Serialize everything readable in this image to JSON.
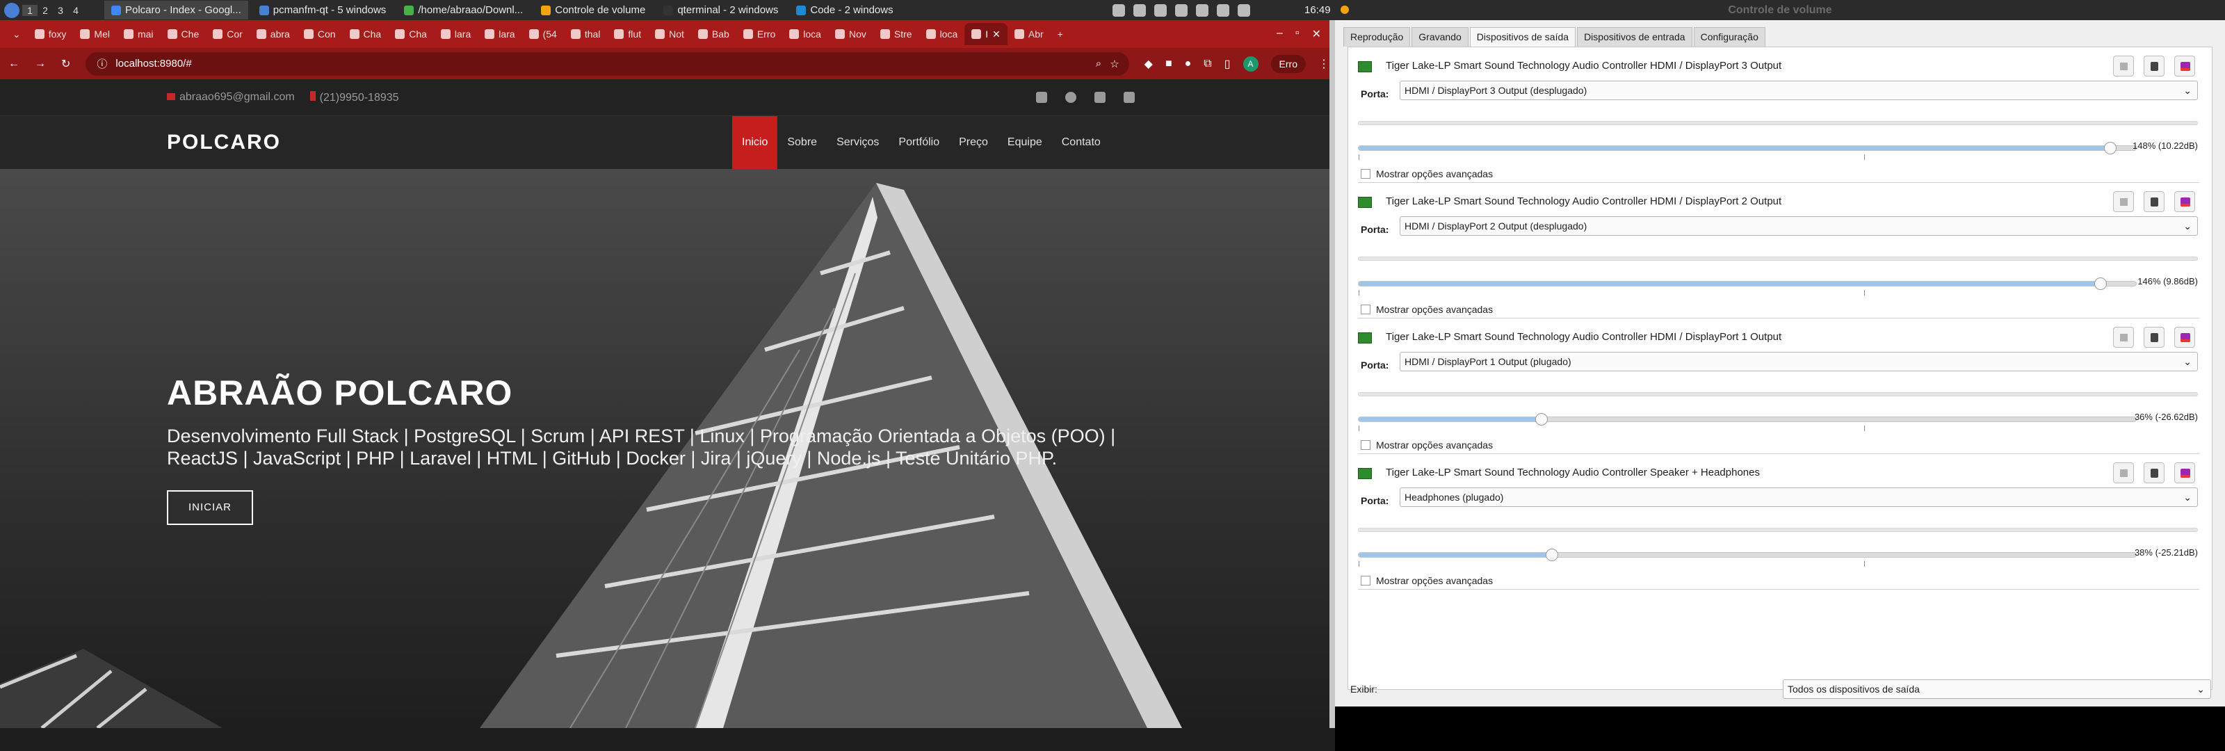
{
  "taskbar": {
    "workspaces": [
      "1",
      "2",
      "3",
      "4"
    ],
    "tasks": [
      {
        "label": "Polcaro - Index - Googl...",
        "color": "#4285f4",
        "active": true
      },
      {
        "label": "pcmanfm-qt - 5 windows",
        "color": "#4a7fd6",
        "active": false
      },
      {
        "label": "/home/abraao/Downl...",
        "color": "#48b04a",
        "active": false
      },
      {
        "label": "Controle de volume",
        "color": "#f5a30f",
        "active": false
      },
      {
        "label": "qterminal - 2 windows",
        "color": "#333333",
        "active": false
      },
      {
        "label": "Code - 2 windows",
        "color": "#1f8ad2",
        "active": false
      }
    ],
    "clock": "16:49",
    "window_title": "Controle de volume"
  },
  "browser": {
    "tabs": [
      "foxy",
      "Mel",
      "mai",
      "Che",
      "Cor",
      "abra",
      "Con",
      "Cha",
      "Cha",
      "lara",
      "lara",
      "(54",
      "thal",
      "flut",
      "Not",
      "Bab",
      "Erro",
      "loca",
      "Nov",
      "Stre",
      "loca",
      "I",
      "Abr"
    ],
    "active_tab_index": 21,
    "url": "localhost:8980/#",
    "avatar_letter": "A",
    "error_label": "Erro"
  },
  "site": {
    "email": "abraao695@gmail.com",
    "phone": "(21)9950-18935",
    "social": [
      "twitter-icon",
      "facebook-icon",
      "instagram-icon",
      "linkedin-icon"
    ],
    "brand": "POLCARO",
    "menu": [
      "Inicio",
      "Sobre",
      "Serviços",
      "Portfólio",
      "Preço",
      "Equipe",
      "Contato"
    ],
    "hero_title": "ABRAÃO POLCARO",
    "hero_subtitle": "Desenvolvimento Full Stack | PostgreSQL | Scrum | API REST | Linux | Programação Orientada a Objetos (POO) | ReactJS | JavaScript | PHP | Laravel | HTML | GitHub | Docker | Jira | jQuery | Node.js | Teste Unitário PHP.",
    "cta": "INICIAR"
  },
  "volume": {
    "tabs": [
      "Reprodução",
      "Gravando",
      "Dispositivos de saída",
      "Dispositivos de entrada",
      "Configuração"
    ],
    "active_tab": 2,
    "port_label": "Porta:",
    "advanced_label": "Mostrar opções avançadas",
    "devices": [
      {
        "name": "Tiger Lake-LP Smart Sound Technology Audio Controller HDMI / DisplayPort 3 Output",
        "port": "HDMI / DisplayPort 3 Output (desplugado)",
        "volume_pct": 148,
        "volume_label": "148% (10.22dB)"
      },
      {
        "name": "Tiger Lake-LP Smart Sound Technology Audio Controller HDMI / DisplayPort 2 Output",
        "port": "HDMI / DisplayPort 2 Output (desplugado)",
        "volume_pct": 146,
        "volume_label": "146% (9.86dB)"
      },
      {
        "name": "Tiger Lake-LP Smart Sound Technology Audio Controller HDMI / DisplayPort 1 Output",
        "port": "HDMI / DisplayPort 1 Output (plugado)",
        "volume_pct": 36,
        "volume_label": "36% (-26.62dB)"
      },
      {
        "name": "Tiger Lake-LP Smart Sound Technology Audio Controller Speaker + Headphones",
        "port": "Headphones (plugado)",
        "volume_pct": 38,
        "volume_label": "38% (-25.21dB)"
      }
    ],
    "show_label": "Exibir:",
    "show_value": "Todos os dispositivos de saída"
  }
}
